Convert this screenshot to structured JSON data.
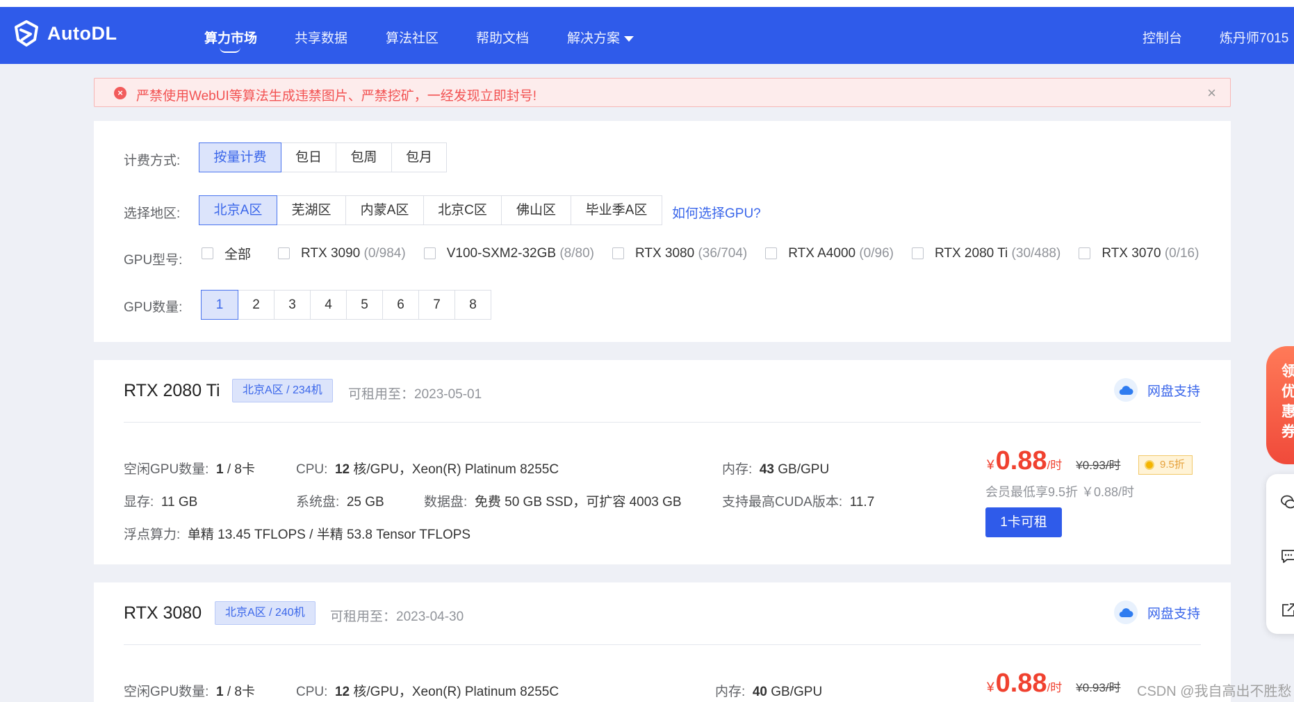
{
  "app": {
    "name": "AutoDL"
  },
  "nav": {
    "items": [
      "算力市场",
      "共享数据",
      "算法社区",
      "帮助文档",
      "解决方案"
    ],
    "console": "控制台",
    "user": "炼丹师7015"
  },
  "alert": {
    "text": "严禁使用WebUI等算法生成违禁图片、严禁挖矿，一经发现立即封号!",
    "close": "×"
  },
  "filters": {
    "billing_label": "计费方式:",
    "billing_options": [
      "按量计费",
      "包日",
      "包周",
      "包月"
    ],
    "billing_selected": "按量计费",
    "region_label": "选择地区:",
    "region_options": [
      "北京A区",
      "芜湖区",
      "内蒙A区",
      "北京C区",
      "佛山区",
      "毕业季A区"
    ],
    "region_selected": "北京A区",
    "region_help": "如何选择GPU?",
    "gpu_type_label": "GPU型号:",
    "gpu_types": [
      {
        "name": "全部",
        "count": ""
      },
      {
        "name": "RTX 3090",
        "count": "(0/984)"
      },
      {
        "name": "V100-SXM2-32GB",
        "count": "(8/80)"
      },
      {
        "name": "RTX 3080",
        "count": "(36/704)"
      },
      {
        "name": "RTX A4000",
        "count": "(0/96)"
      },
      {
        "name": "RTX 2080 Ti",
        "count": "(30/488)"
      },
      {
        "name": "RTX 3070",
        "count": "(0/16)"
      }
    ],
    "gpu_count_label": "GPU数量:",
    "gpu_counts": [
      "1",
      "2",
      "3",
      "4",
      "5",
      "6",
      "7",
      "8"
    ],
    "gpu_count_selected": "1"
  },
  "cards": [
    {
      "gpu": "RTX 2080 Ti",
      "region_tag": "北京A区 / 234机",
      "available_until": "可租用至：2023-05-01",
      "disk_support": "网盘支持",
      "idle_label": "空闲GPU数量:",
      "idle_value": "1",
      "idle_total": " / 8卡",
      "cpu_label": "CPU:",
      "cpu_cores": "12",
      "cpu_rest": " 核/GPU，Xeon(R) Platinum 8255C",
      "mem_label": "内存:",
      "mem_value": "43",
      "mem_unit": " GB/GPU",
      "vram_label": "显存:",
      "vram_value": "11 GB",
      "sysdisk_label": "系统盘:",
      "sysdisk_value": "25 GB",
      "datadisk_label": "数据盘:",
      "datadisk_value": "免费 50 GB SSD，可扩容 4003 GB",
      "cuda_label": "支持最高CUDA版本:",
      "cuda_value": "11.7",
      "flops_label": "浮点算力:",
      "flops_value": "单精 13.45 TFLOPS / 半精 53.8 Tensor TFLOPS",
      "price_symbol": "¥",
      "price": "0.88",
      "price_unit": "/时",
      "orig_price": "¥0.93/时",
      "discount": "9.5折",
      "member_text": "会员最低享9.5折 ￥0.88/时",
      "rent_label": "1卡可租"
    },
    {
      "gpu": "RTX 3080",
      "region_tag": "北京A区 / 240机",
      "available_until": "可租用至：2023-04-30",
      "disk_support": "网盘支持",
      "idle_label": "空闲GPU数量:",
      "idle_value": "1",
      "idle_total": " / 8卡",
      "cpu_label": "CPU:",
      "cpu_cores": "12",
      "cpu_rest": " 核/GPU，Xeon(R) Platinum 8255C",
      "mem_label": "内存:",
      "mem_value": "40",
      "mem_unit": " GB/GPU",
      "price_symbol": "¥",
      "price": "0.88",
      "price_unit": "/时",
      "orig_price": "¥0.93/时"
    }
  ],
  "coupon": {
    "chars": [
      "领",
      "优",
      "惠",
      "券"
    ]
  },
  "watermark": "CSDN @我自高出不胜愁",
  "colors": {
    "primary": "#2f5bea",
    "price": "#f0412f",
    "alert_bg": "#fdecec"
  }
}
